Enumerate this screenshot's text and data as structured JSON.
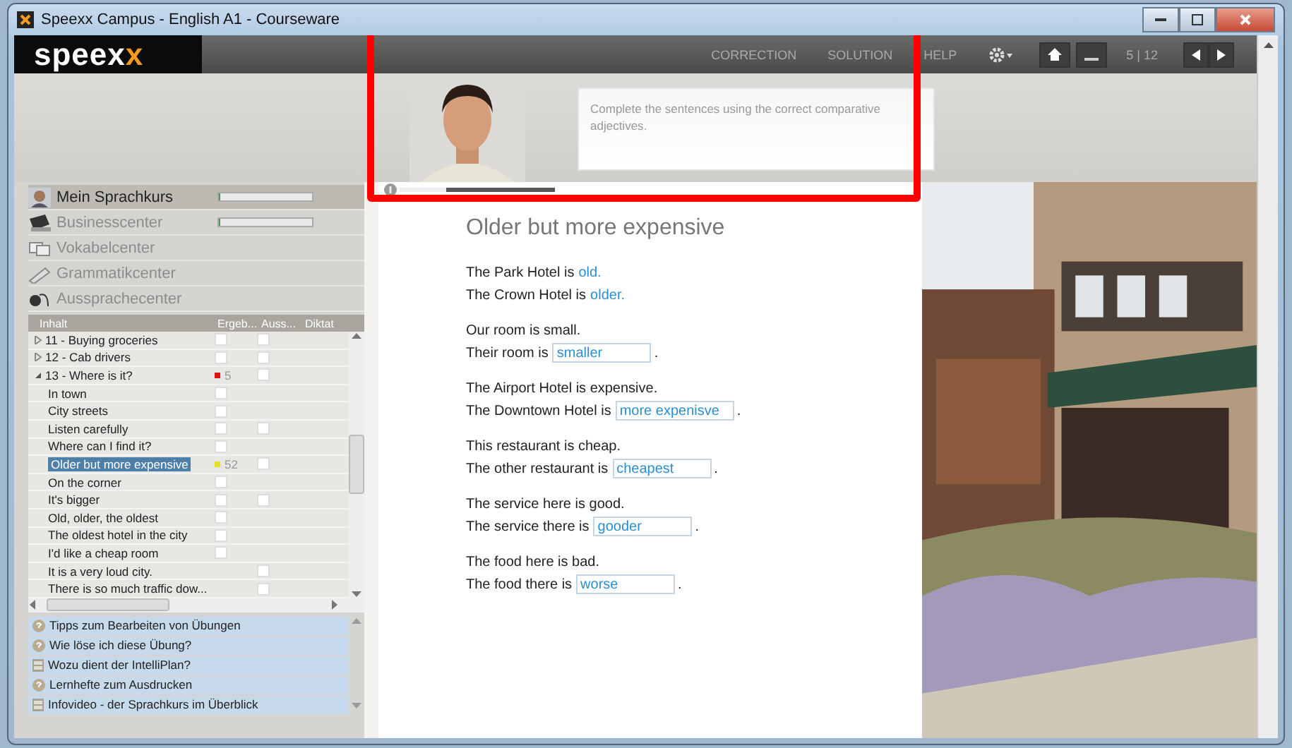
{
  "window": {
    "title": "Speexx Campus - English A1 - Courseware"
  },
  "logo": {
    "text": "speex",
    "accent": "x"
  },
  "toolbar": {
    "items": [
      "CORRECTION",
      "SOLUTION",
      "HELP"
    ],
    "page": "5 | 12"
  },
  "instruction": "Complete the sentences using the correct comparative adjectives.",
  "progress": {
    "level": 0.3
  },
  "nav": [
    {
      "label": "Mein Sprachkurs",
      "selected": true,
      "disabled": false,
      "level": 0.02,
      "kind": "person"
    },
    {
      "label": "Businesscenter",
      "selected": false,
      "disabled": true,
      "level": 0.02,
      "kind": "laptop"
    },
    {
      "label": "Vokabelcenter",
      "selected": false,
      "disabled": true,
      "kind": "cards"
    },
    {
      "label": "Grammatikcenter",
      "selected": false,
      "disabled": true,
      "kind": "pen"
    },
    {
      "label": "Aussprachecenter",
      "selected": false,
      "disabled": true,
      "kind": "headset"
    }
  ],
  "tree": {
    "columns": [
      "Inhalt",
      "Ergeb...",
      "Auss...",
      "Diktat"
    ],
    "items": [
      {
        "label": "11 - Buying groceries",
        "expanded": false,
        "result_checked": false,
        "speech_checked": false,
        "selected": false
      },
      {
        "label": "12 - Cab drivers",
        "expanded": false,
        "result_checked": false,
        "speech_checked": false,
        "selected": false
      },
      {
        "label": "13 - Where is it?",
        "expanded": true,
        "color": "#dd1111",
        "score": "5",
        "speech_checked": false,
        "selected": false,
        "children": [
          {
            "label": "In town",
            "result_checked": false,
            "selected": false
          },
          {
            "label": "City streets",
            "result_checked": false,
            "selected": false
          },
          {
            "label": "Listen carefully",
            "result_checked": false,
            "speech_checked": false,
            "selected": false
          },
          {
            "label": "Where can I find it?",
            "result_checked": false,
            "selected": false
          },
          {
            "label": "Older but more expensive",
            "color": "#e8e020",
            "score": "52",
            "speech_checked": false,
            "selected": true
          },
          {
            "label": "On the corner",
            "result_checked": false,
            "selected": false
          },
          {
            "label": "It's bigger",
            "result_checked": false,
            "speech_checked": false,
            "selected": false
          },
          {
            "label": "Old, older, the oldest",
            "result_checked": false,
            "selected": false
          },
          {
            "label": "The oldest hotel in the city",
            "result_checked": false,
            "selected": false
          },
          {
            "label": "I'd like a cheap room",
            "result_checked": false,
            "selected": false
          },
          {
            "label": "It is a very loud city.",
            "speech_checked": false,
            "selected": false
          },
          {
            "label": "There is so much traffic dow...",
            "speech_checked": false,
            "selected": false
          }
        ]
      }
    ]
  },
  "help_links": [
    {
      "label": "Tipps zum Bearbeiten von Übungen",
      "kind": "question"
    },
    {
      "label": "Wie löse ich diese Übung?",
      "kind": "question"
    },
    {
      "label": "Wozu dient der IntelliPlan?",
      "kind": "video"
    },
    {
      "label": "Lernhefte zum Ausdrucken",
      "kind": "question"
    },
    {
      "label": "Infovideo - der Sprachkurs im Überblick",
      "kind": "video"
    }
  ],
  "exercise": {
    "title": "Older but more expensive",
    "blocks": [
      [
        {
          "text": "The Park Hotel is",
          "answer": "old.",
          "kind": "given"
        },
        {
          "text": "The Crown Hotel is",
          "answer": "older.",
          "kind": "given"
        }
      ],
      [
        {
          "text": "Our room is small.",
          "kind": "plain"
        },
        {
          "text": "Their room is",
          "value": "smaller",
          "suffix": ".",
          "kind": "field"
        }
      ],
      [
        {
          "text": "The Airport Hotel is expensive.",
          "kind": "plain"
        },
        {
          "text": "The Downtown Hotel is",
          "value": "more expenisve",
          "suffix": ".",
          "kind": "field"
        }
      ],
      [
        {
          "text": "This restaurant is cheap.",
          "kind": "plain"
        },
        {
          "text": "The other restaurant is",
          "value": "cheapest",
          "suffix": ".",
          "kind": "field"
        }
      ],
      [
        {
          "text": "The service here is good.",
          "kind": "plain"
        },
        {
          "text": "The service there is",
          "value": "gooder",
          "suffix": ".",
          "kind": "field"
        }
      ],
      [
        {
          "text": "The food here is bad.",
          "kind": "plain"
        },
        {
          "text": "The food there is",
          "value": "worse",
          "suffix": ".",
          "kind": "field"
        }
      ]
    ]
  }
}
